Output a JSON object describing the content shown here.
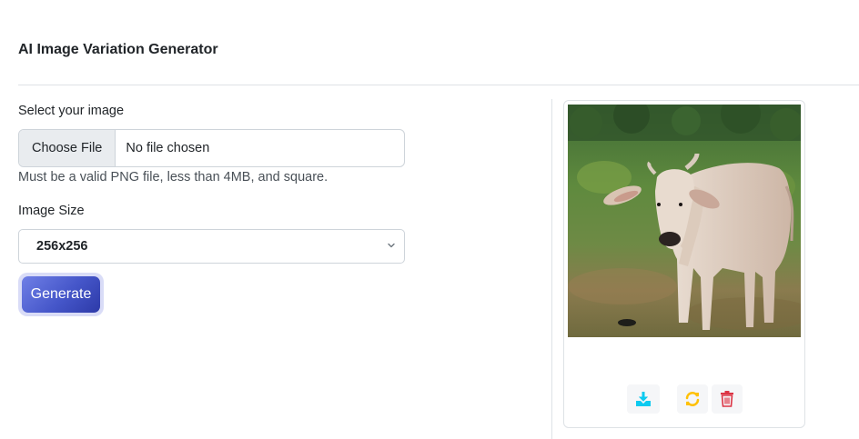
{
  "header": {
    "title": "AI Image Variation Generator"
  },
  "form": {
    "file_label": "Select your image",
    "file_button": "Choose File",
    "file_status": "No file chosen",
    "file_help": "Must be a valid PNG file, less than 4MB, and square.",
    "size_label": "Image Size",
    "size_selected": "256x256",
    "generate_label": "Generate"
  },
  "result": {
    "image": "cow-photo",
    "actions": [
      {
        "icon": "download-icon",
        "color": "#0dcaf0"
      },
      {
        "icon": "refresh-icon",
        "color": "#ffc107"
      },
      {
        "icon": "trash-icon",
        "color": "#dc3545"
      }
    ]
  },
  "colors": {
    "accent_gradient_start": "#6f7fe6",
    "accent_gradient_end": "#2d3aa8",
    "border": "#dee2e6"
  }
}
